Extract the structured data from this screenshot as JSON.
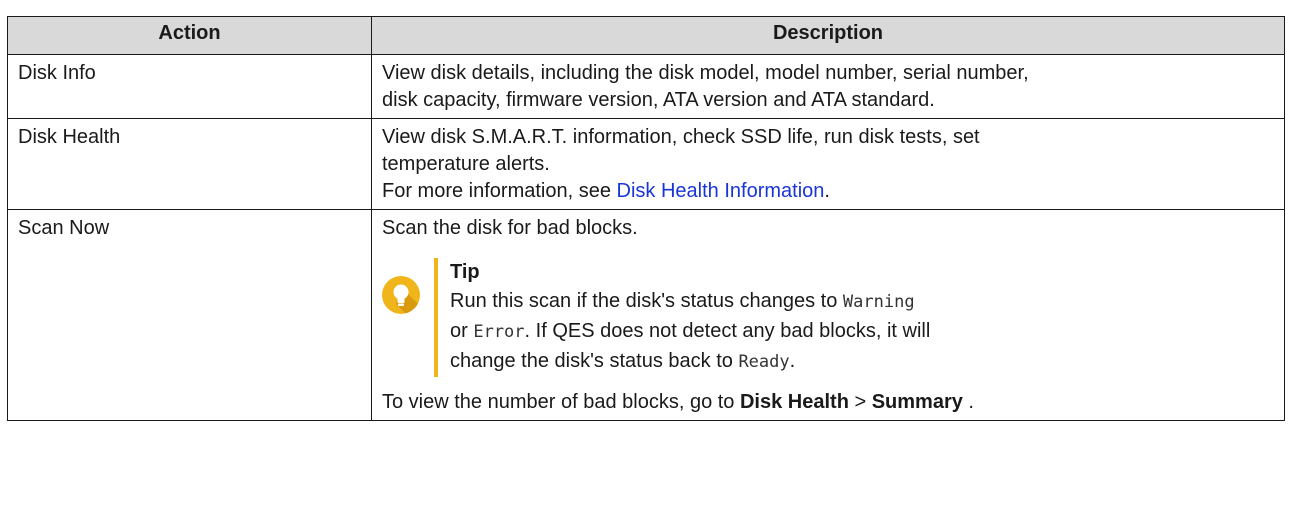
{
  "table": {
    "headers": {
      "action": "Action",
      "description": "Description"
    },
    "rows": [
      {
        "action": "Disk Info",
        "description_lines": [
          "View disk details, including the disk model, model number, serial number,",
          "disk capacity, firmware version, ATA version and ATA standard."
        ]
      },
      {
        "action": "Disk Health",
        "description_lines": [
          "View disk S.M.A.R.T. information, check SSD life, run disk tests, set",
          "temperature alerts."
        ],
        "see_prefix": "For more information, see ",
        "see_link": "Disk Health Information",
        "see_suffix": "."
      },
      {
        "action": "Scan Now",
        "description": "Scan the disk for bad blocks.",
        "tip": {
          "icon": "lightbulb-icon",
          "title": "Tip",
          "line1_text": "Run this scan if the disk's status changes to ",
          "status_warning": "Warning",
          "line2_prefix": "or ",
          "status_error": "Error",
          "line2_text": ". If QES does not detect any bad blocks, it will",
          "line3_text": "change the disk's status back to ",
          "status_ready": "Ready",
          "line3_suffix": "."
        },
        "footer_prefix": "To view the number of bad blocks, go to ",
        "footer_menu1": "Disk Health",
        "footer_sep": " > ",
        "footer_menu2": "Summary",
        "footer_suffix": " ."
      }
    ]
  },
  "colors": {
    "header_bg": "#d9d9d9",
    "tip_accent": "#f1b51c",
    "link": "#1a35d6"
  }
}
